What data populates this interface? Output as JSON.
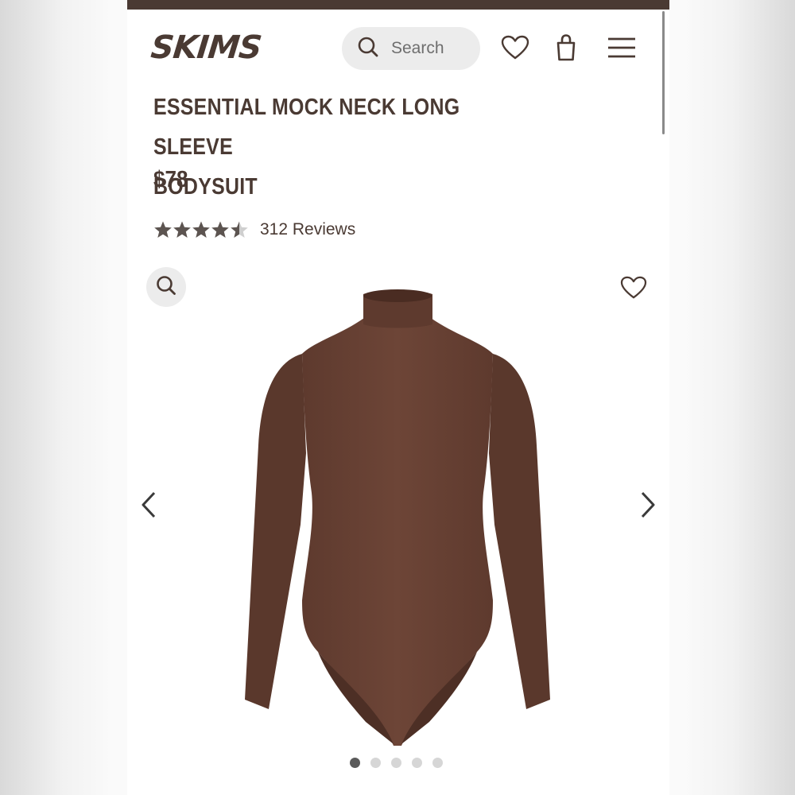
{
  "brand": {
    "logo_text": "SKIMS"
  },
  "header": {
    "search_placeholder": "Search",
    "icons": [
      "search-icon",
      "heart-icon",
      "shopping-bag-icon",
      "menu-icon"
    ]
  },
  "product": {
    "title_line1": "ESSENTIAL MOCK NECK LONG SLEEVE",
    "title_line2": "BODYSUIT",
    "price": "$78",
    "rating_value": 4.5,
    "rating_max": 5,
    "reviews_label": "312 Reviews",
    "color_hex": "#6a4234"
  },
  "gallery": {
    "total_images": 5,
    "current_index": 1,
    "icons": [
      "zoom-icon",
      "wishlist-heart-icon",
      "chevron-left-icon",
      "chevron-right-icon"
    ]
  },
  "colors": {
    "brand_brown": "#4a3a33",
    "star": "#5c5450",
    "star_empty": "#cfcfcf"
  }
}
